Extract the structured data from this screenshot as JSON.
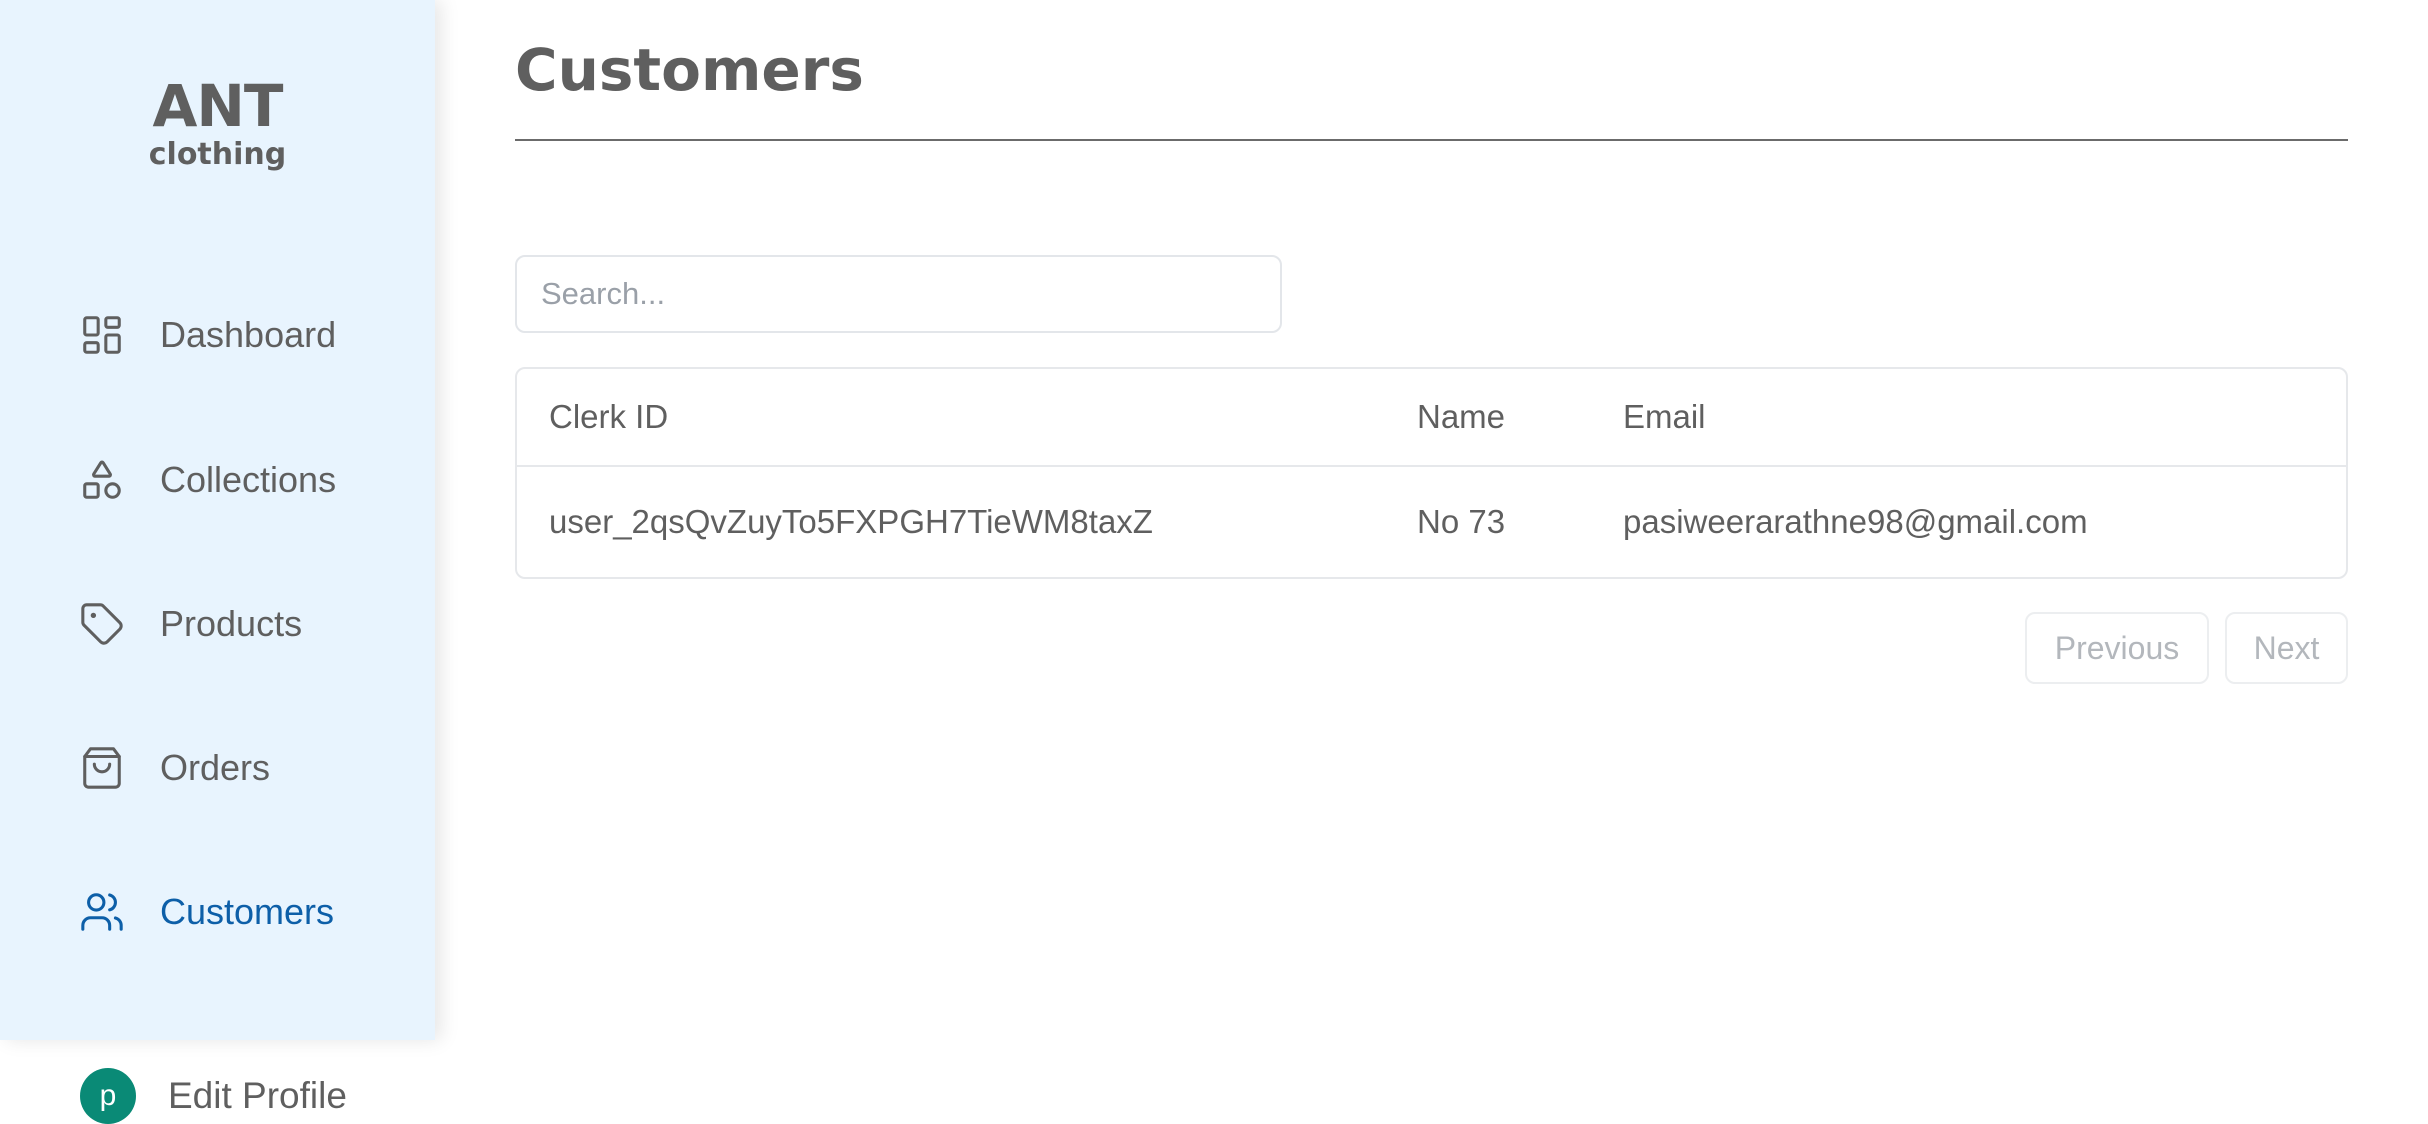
{
  "brand": {
    "name": "ANT",
    "tagline": "clothing"
  },
  "sidebar": {
    "items": [
      {
        "label": "Dashboard",
        "icon": "dashboard-icon",
        "active": false
      },
      {
        "label": "Collections",
        "icon": "shapes-icon",
        "active": false
      },
      {
        "label": "Products",
        "icon": "tag-icon",
        "active": false
      },
      {
        "label": "Orders",
        "icon": "shopping-bag-icon",
        "active": false
      },
      {
        "label": "Customers",
        "icon": "users-icon",
        "active": true
      }
    ],
    "profile": {
      "avatar_letter": "p",
      "label": "Edit Profile"
    }
  },
  "page": {
    "title": "Customers"
  },
  "search": {
    "placeholder": "Search...",
    "value": ""
  },
  "table": {
    "columns": [
      "Clerk ID",
      "Name",
      "Email"
    ],
    "rows": [
      [
        "user_2qsQvZuyTo5FXPGH7TieWM8taxZ",
        "No 73",
        "pasiweerarathne98@gmail.com"
      ]
    ]
  },
  "pagination": {
    "previous_label": "Previous",
    "next_label": "Next"
  },
  "colors": {
    "sidebar_bg": "#e8f4fe",
    "accent": "#0d5fa8",
    "avatar_bg": "#0a8a76",
    "text": "#5f5f5f"
  }
}
